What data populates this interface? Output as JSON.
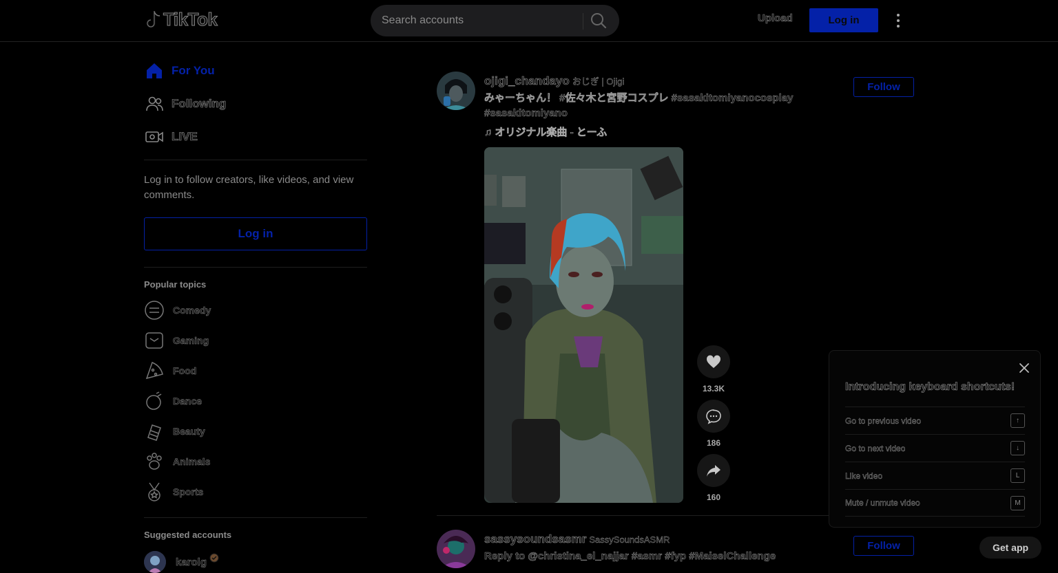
{
  "header": {
    "logo_text": "TikTok",
    "search_placeholder": "Search accounts",
    "upload_label": "Upload",
    "login_label": "Log in"
  },
  "sidebar": {
    "nav": [
      {
        "label": "For You",
        "icon": "home-icon",
        "active": true
      },
      {
        "label": "Following",
        "icon": "people-icon",
        "active": false
      },
      {
        "label": "LIVE",
        "icon": "live-icon",
        "active": false
      }
    ],
    "login_hint": "Log in to follow creators, like videos, and view comments.",
    "login_label": "Log in",
    "popular_title": "Popular topics",
    "topics": [
      {
        "label": "Comedy",
        "icon": "comedy-icon"
      },
      {
        "label": "Gaming",
        "icon": "gaming-icon"
      },
      {
        "label": "Food",
        "icon": "food-icon"
      },
      {
        "label": "Dance",
        "icon": "dance-icon"
      },
      {
        "label": "Beauty",
        "icon": "beauty-icon"
      },
      {
        "label": "Animals",
        "icon": "animals-icon"
      },
      {
        "label": "Sports",
        "icon": "sports-icon"
      }
    ],
    "suggested_title": "Suggested accounts",
    "suggested": [
      {
        "name": "karolg",
        "verified": true
      }
    ]
  },
  "posts": [
    {
      "username": "ojigi_chandayo",
      "nickname": "おじぎ | Ojigi",
      "caption": "みゃーちゃん！ #佐々木と宮野コスプレ #sasakitomiyanocosplay #sasakitomiyano",
      "music": "♫ オリジナル楽曲 - とーふ",
      "follow_label": "Follow",
      "likes": "13.3K",
      "comments": "186",
      "shares": "160"
    },
    {
      "username": "sassysoundsasmr",
      "nickname": "SassySoundsASMR",
      "caption": "Reply to @christina_el_najjar #asmr #fyp #MaiselChallenge",
      "follow_label": "Follow"
    }
  ],
  "shortcuts": {
    "title": "Introducing keyboard shortcuts!",
    "items": [
      {
        "label": "Go to previous video",
        "key": "↑"
      },
      {
        "label": "Go to next video",
        "key": "↓"
      },
      {
        "label": "Like video",
        "key": "L"
      },
      {
        "label": "Mute / unmute video",
        "key": "M"
      }
    ]
  },
  "get_app_label": "Get app",
  "colors": {
    "accent": "#0421a8",
    "background": "#000000"
  }
}
